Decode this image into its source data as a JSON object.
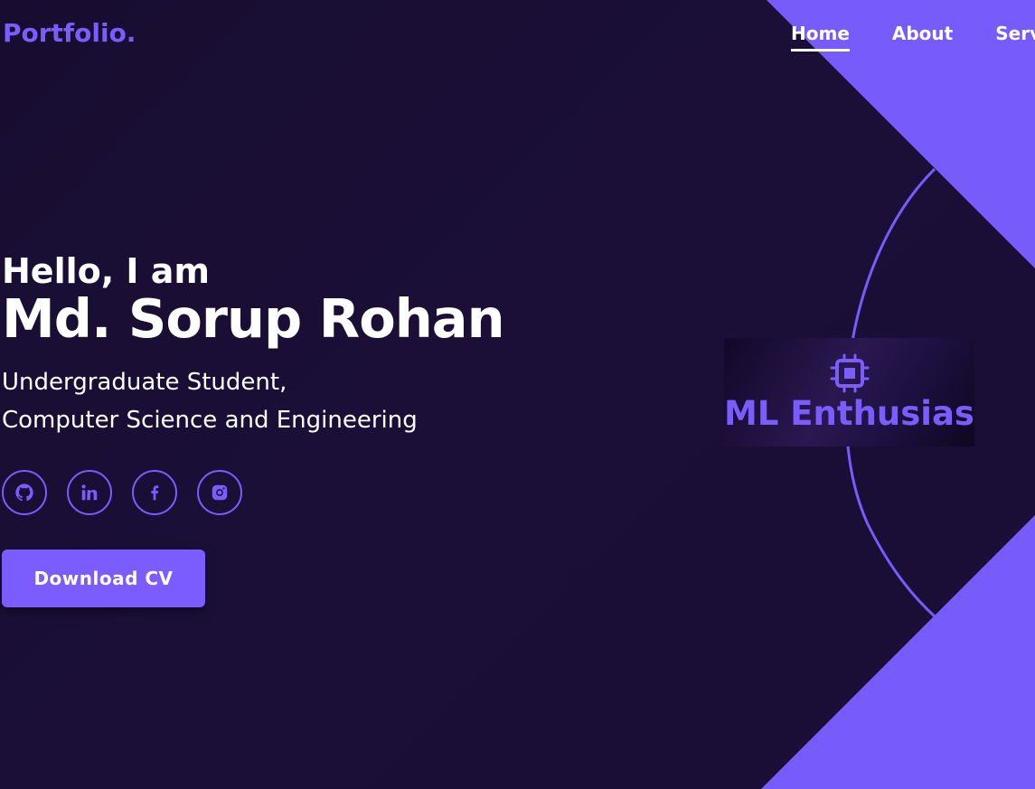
{
  "nav": {
    "logo": "Portfolio.",
    "links": [
      "Home",
      "About",
      "Servi"
    ],
    "active": "Home"
  },
  "hero": {
    "greeting": "Hello, I am",
    "name": "Md. Sorup Rohan",
    "role_line1": "Undergraduate Student,",
    "role_line2": "Computer Science and Engineering",
    "socials": [
      {
        "icon": "github-icon"
      },
      {
        "icon": "linkedin-icon"
      },
      {
        "icon": "facebook-icon"
      },
      {
        "icon": "instagram-icon"
      }
    ],
    "cta_label": "Download CV"
  },
  "highlight": {
    "icon": "cpu-chip-icon",
    "label": "ML Enthusiast"
  },
  "colors": {
    "background": "#1a0e36",
    "accent": "#7a5cff",
    "text": "#ffffff"
  }
}
